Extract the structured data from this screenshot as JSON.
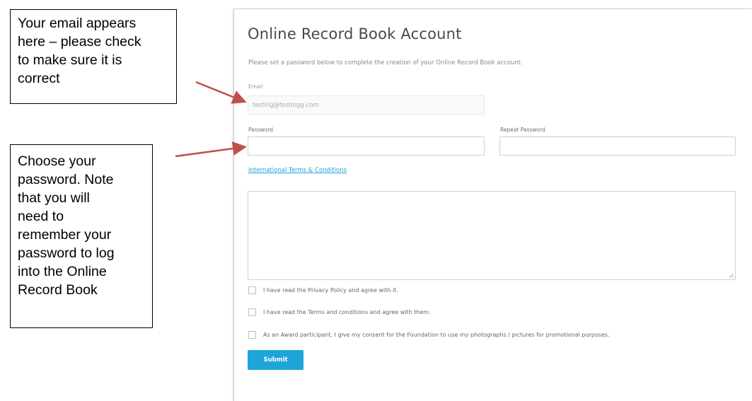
{
  "callouts": {
    "email": [
      "Your email appears",
      "here – please check",
      "to make sure it is",
      "correct"
    ],
    "password": [
      "Choose your",
      "password.  Note",
      "that you will",
      "need to",
      "remember your",
      "password to log",
      "into the Online",
      "Record Book"
    ]
  },
  "form": {
    "title": "Online Record Book Account",
    "subtitle": "Please set a password below to complete the creation of your Online Record Book account.",
    "email_label": "Email",
    "email_value": "testing@testingg.com",
    "password_label": "Password",
    "repeat_password_label": "Repeat Password",
    "password_value": "",
    "repeat_password_value": "",
    "terms_link": "International Terms & Conditions",
    "terms_text": "",
    "checkboxes": [
      {
        "label": "I have read the Privacy Policy and agree with it.",
        "checked": false
      },
      {
        "label": "I have read the Terms and conditions and agree with them.",
        "checked": false
      },
      {
        "label": "As an Award participant, I give my consent for the Foundation to use my photographs / pictures for promotional purposes.",
        "checked": false
      }
    ],
    "submit_label": "Submit"
  },
  "colors": {
    "accent": "#1ea5d8",
    "link": "#1e9fd6",
    "arrow": "#c0504d"
  }
}
